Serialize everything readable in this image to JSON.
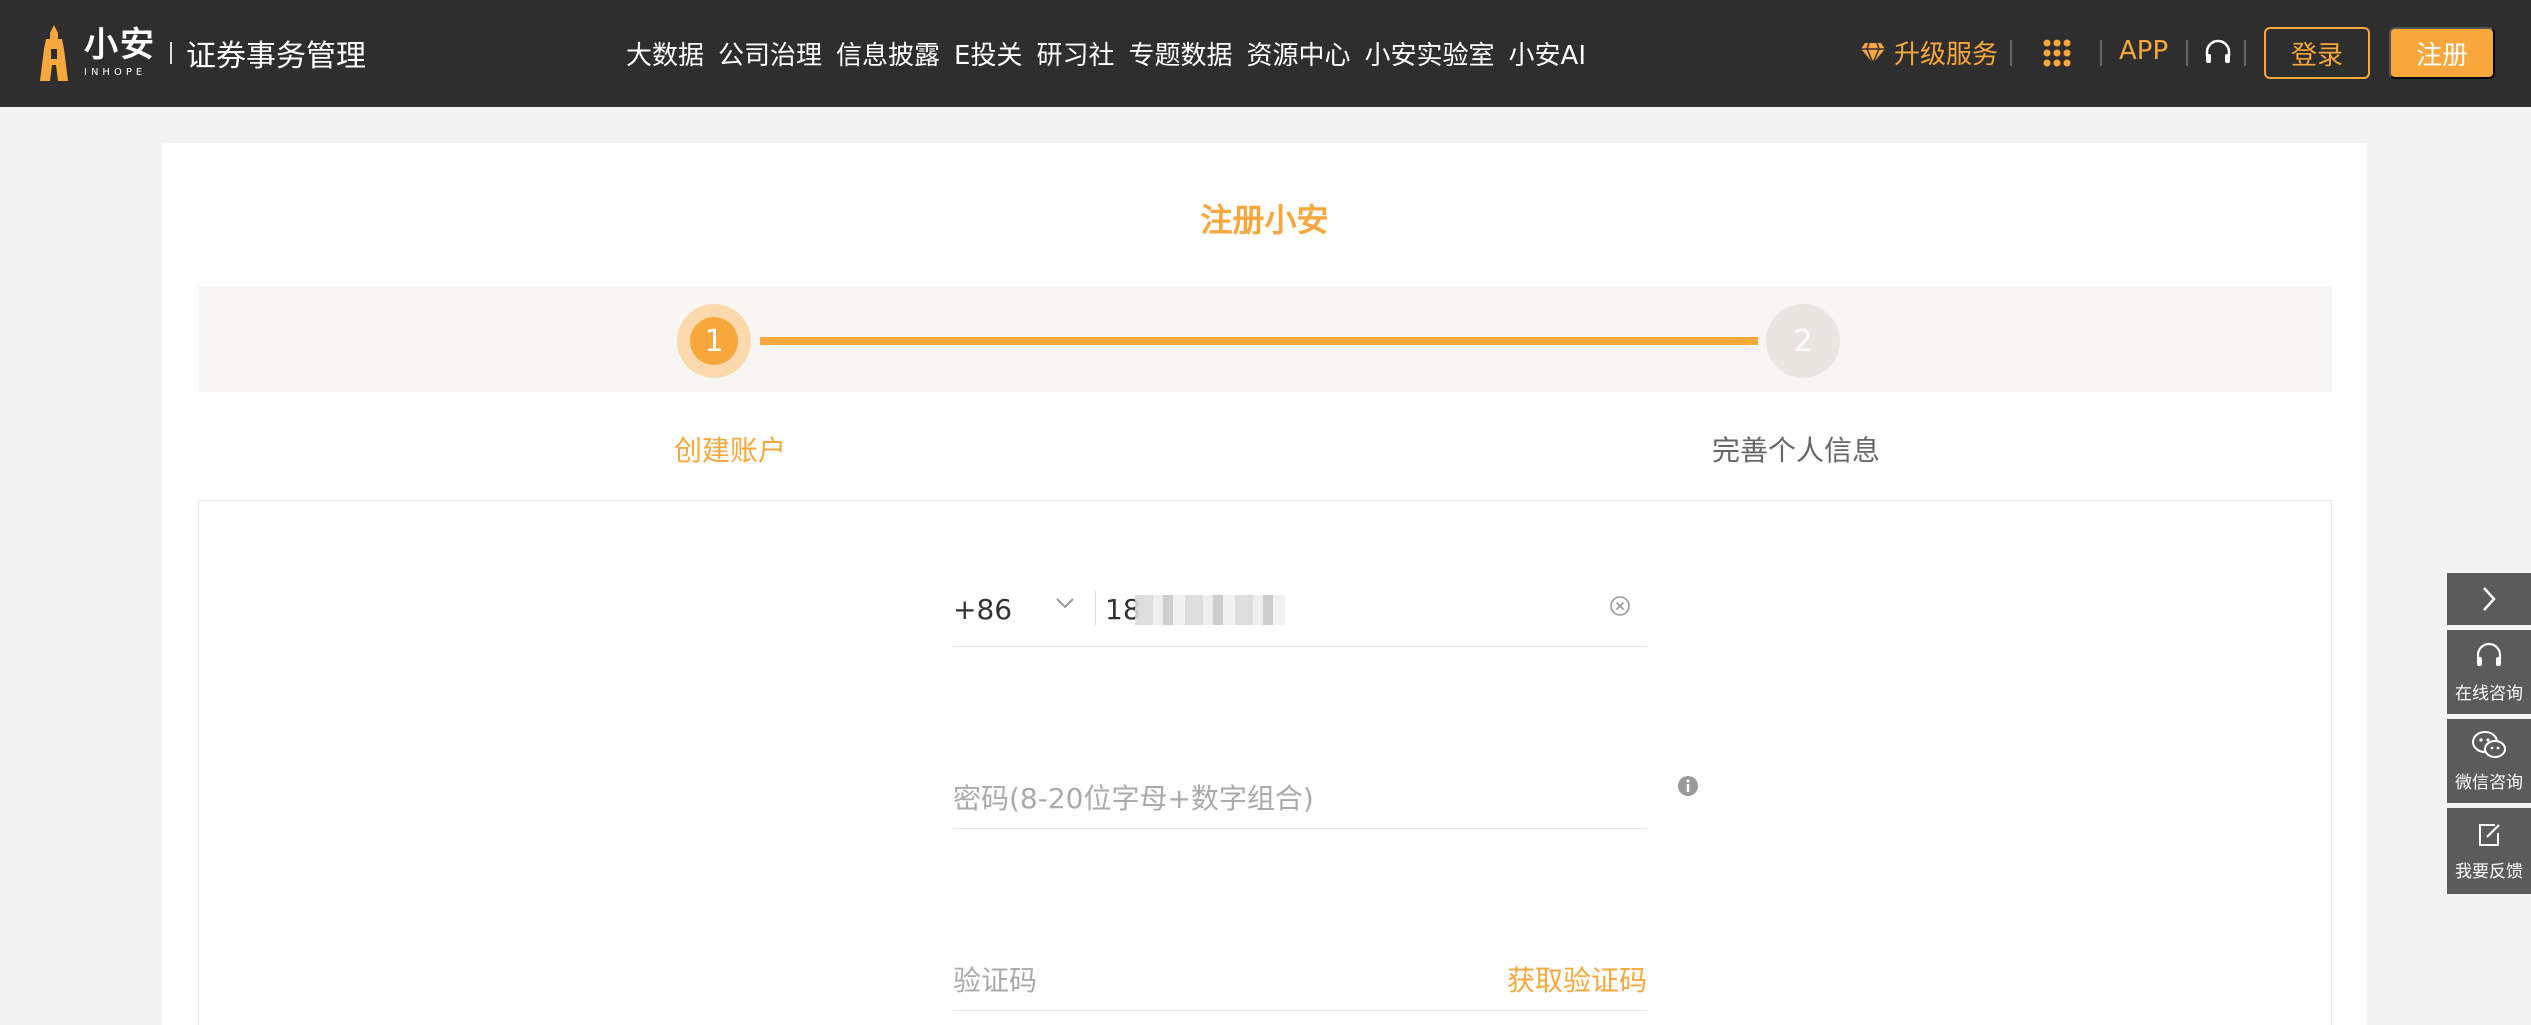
{
  "header": {
    "logo": {
      "cn": "小安",
      "en": "INHOPE",
      "subtitle": "证券事务管理"
    },
    "nav": [
      "大数据",
      "公司治理",
      "信息披露",
      "E投关",
      "研习社",
      "专题数据",
      "资源中心",
      "小安实验室",
      "小安AI"
    ],
    "upgrade_label": "升级服务",
    "app_label": "APP",
    "login_label": "登录",
    "register_label": "注册"
  },
  "page": {
    "title": "注册小安",
    "steps": [
      {
        "number": "1",
        "label": "创建账户",
        "active": true
      },
      {
        "number": "2",
        "label": "完善个人信息",
        "active": false
      }
    ]
  },
  "form": {
    "country_code": "+86",
    "phone_value": "18",
    "password_placeholder": "密码(8-20位字母+数字组合)",
    "code_placeholder": "验证码",
    "get_code_label": "获取验证码"
  },
  "side_panel": {
    "online": "在线咨询",
    "wechat": "微信咨询",
    "feedback": "我要反馈"
  },
  "colors": {
    "accent": "#f8a73c",
    "header_bg": "#2e2e2e",
    "side_bg": "#5b5b5b"
  }
}
